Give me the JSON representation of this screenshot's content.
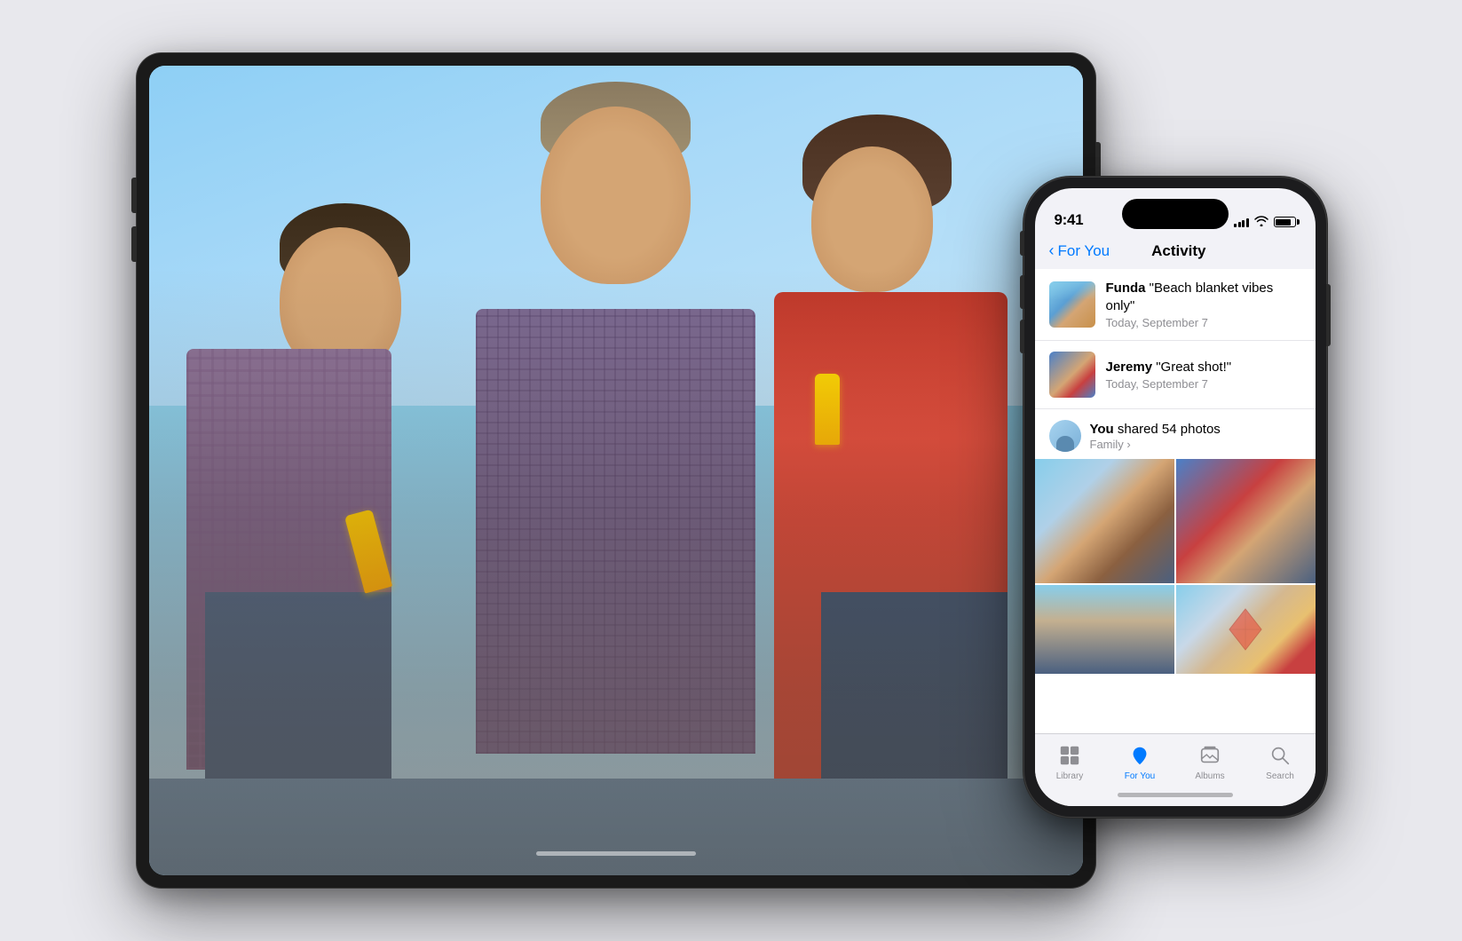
{
  "background_color": "#e8e8ed",
  "ipad": {
    "photo_description": "Family photo with father and two daughters holding popsicles against blue sky"
  },
  "iphone": {
    "status": {
      "time": "9:41",
      "signal_bars": [
        4,
        6,
        8,
        10,
        12
      ],
      "wifi": "wifi",
      "battery_level": 85
    },
    "nav": {
      "back_label": "For You",
      "title": "Activity"
    },
    "activity_items": [
      {
        "id": "funda",
        "name": "Funda",
        "comment": "\"Beach blanket vibes only\"",
        "date": "Today, September 7"
      },
      {
        "id": "jeremy",
        "name": "Jeremy",
        "comment": "\"Great shot!\"",
        "date": "Today, September 7"
      }
    ],
    "shared_post": {
      "poster": "You",
      "action": "shared 54 photos",
      "album": "Family",
      "arrow": "›"
    },
    "tab_bar": {
      "items": [
        {
          "id": "library",
          "label": "Library",
          "active": false
        },
        {
          "id": "for-you",
          "label": "For You",
          "active": true
        },
        {
          "id": "albums",
          "label": "Albums",
          "active": false
        },
        {
          "id": "search",
          "label": "Search",
          "active": false
        }
      ]
    }
  }
}
